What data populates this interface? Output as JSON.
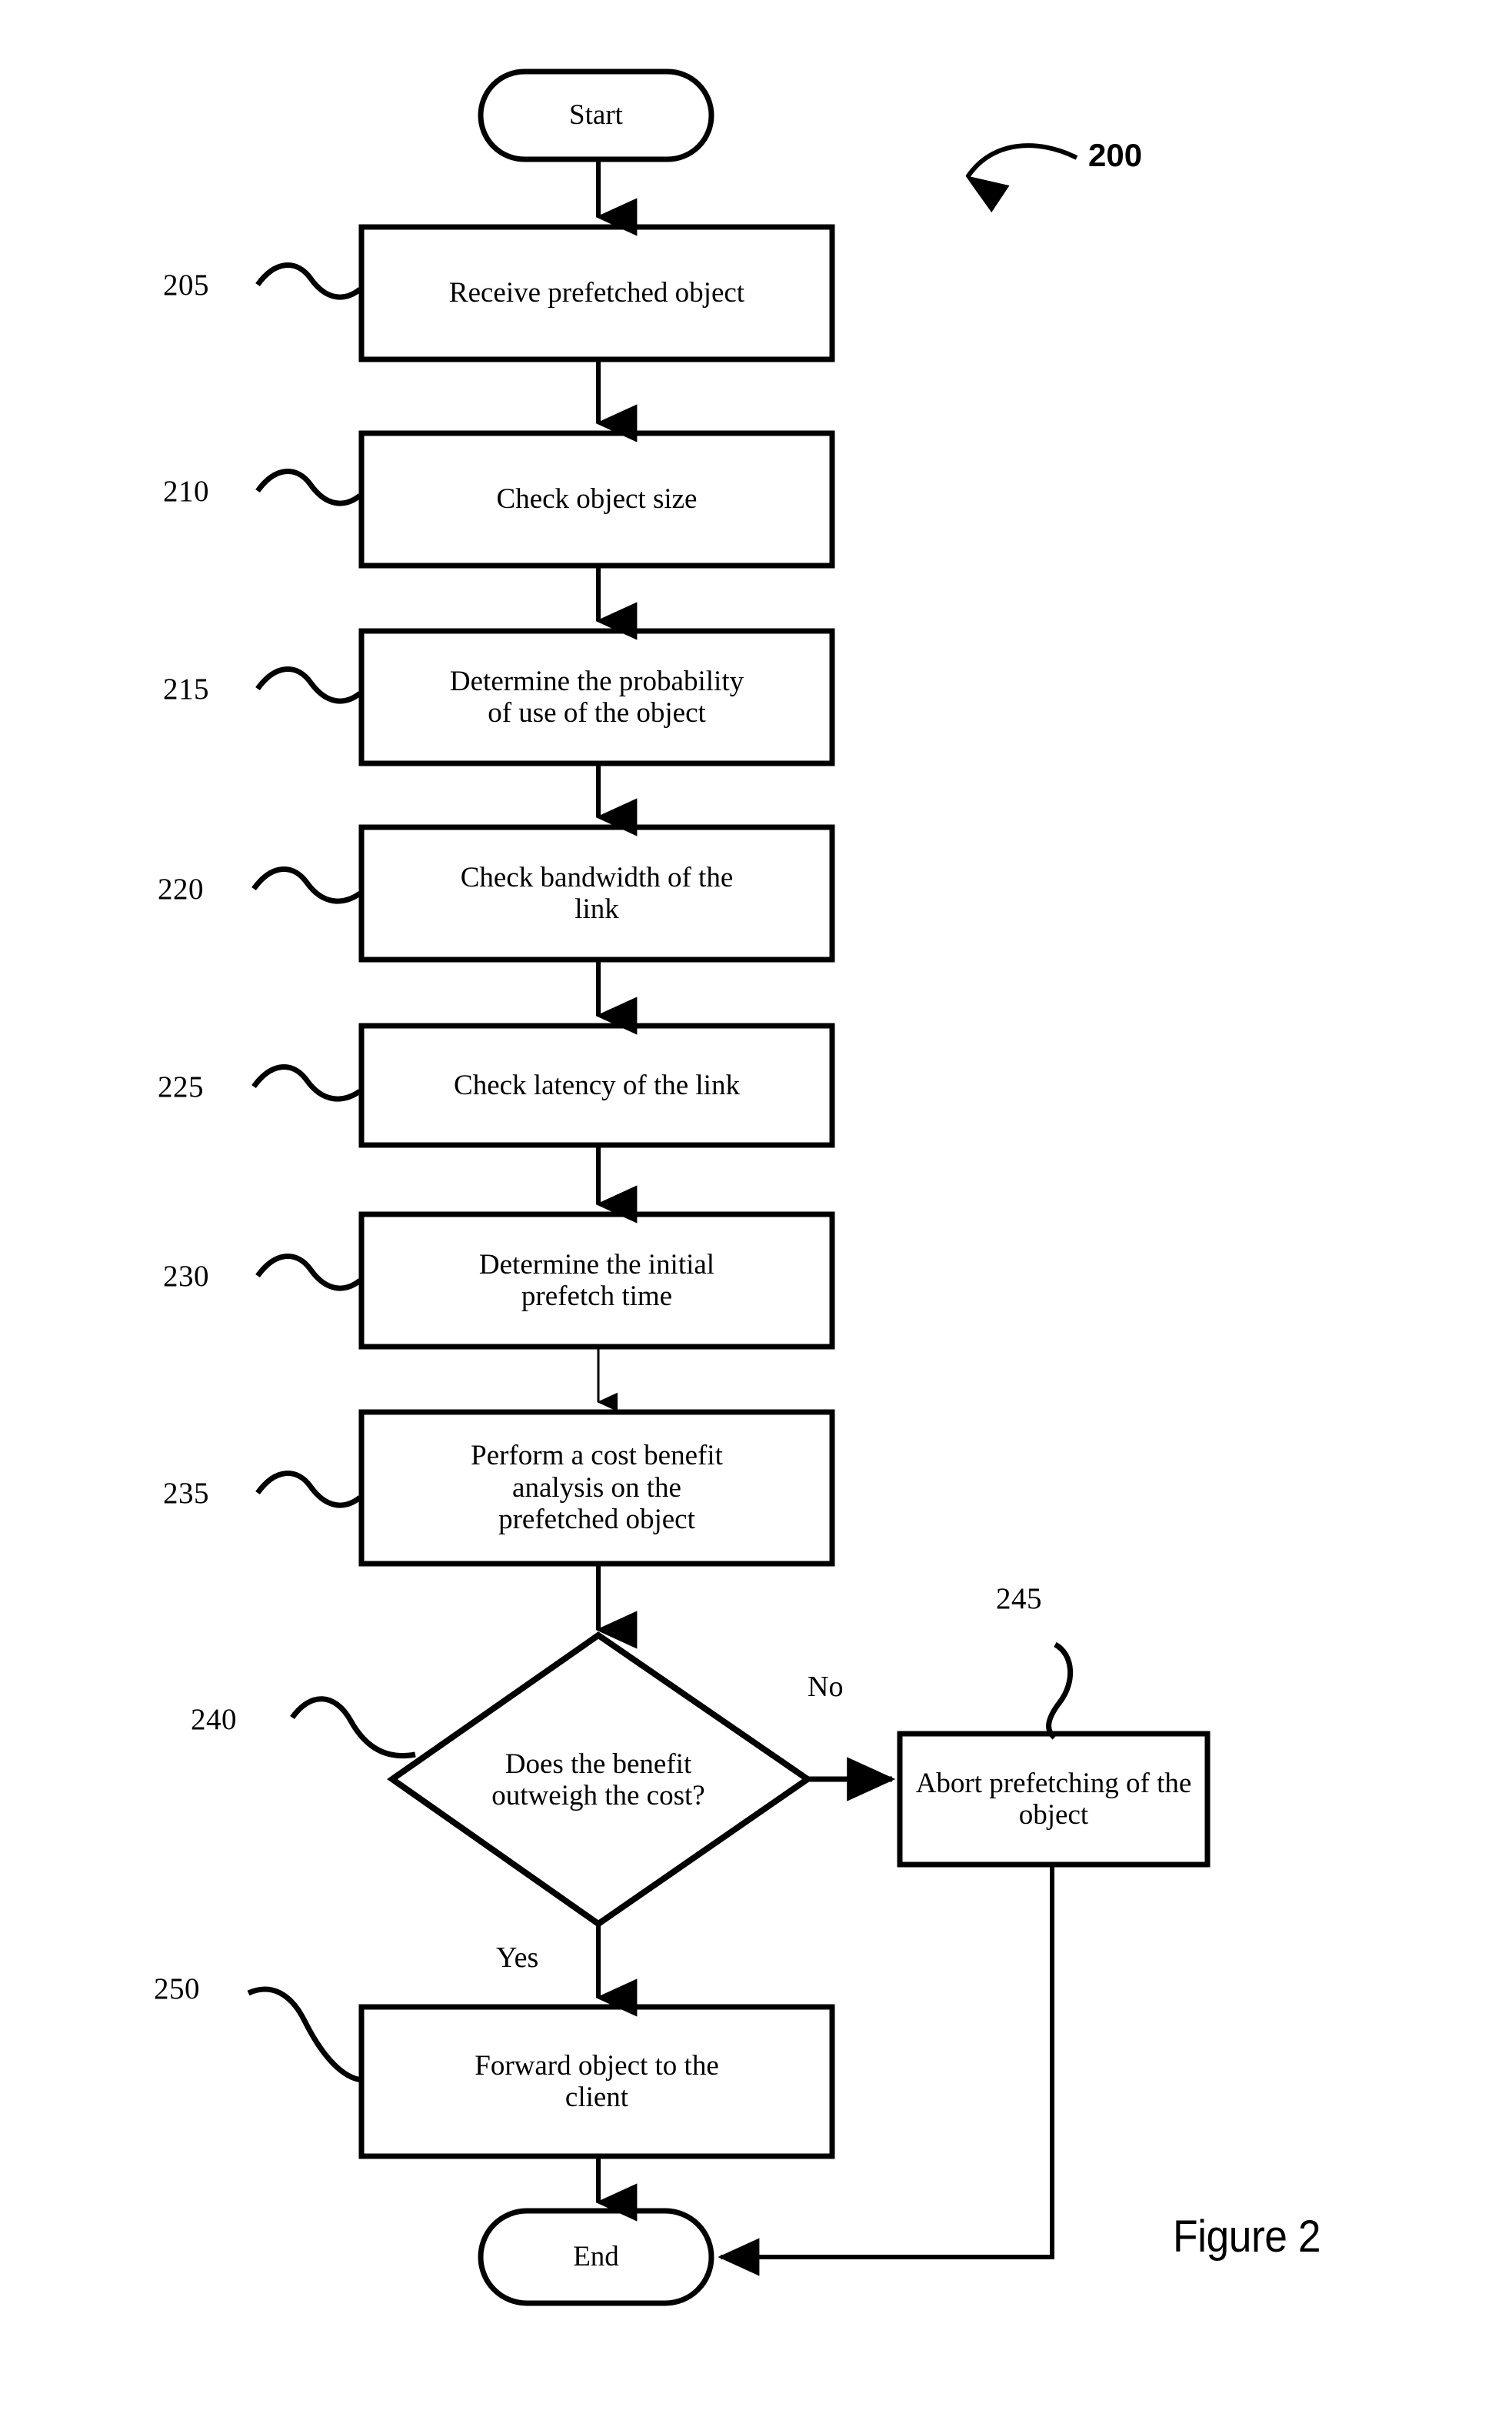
{
  "figure": {
    "caption": "Figure 2",
    "flow_number": "200"
  },
  "terminators": {
    "start": "Start",
    "end": "End"
  },
  "steps": [
    {
      "ref": "205",
      "label": "Receive prefetched object"
    },
    {
      "ref": "210",
      "label": "Check object size"
    },
    {
      "ref": "215",
      "label": "Determine the probability\nof use of the object"
    },
    {
      "ref": "220",
      "label": "Check bandwidth of the\nlink"
    },
    {
      "ref": "225",
      "label": "Check latency of the link"
    },
    {
      "ref": "230",
      "label": "Determine the initial\nprefetch time"
    },
    {
      "ref": "235",
      "label": "Perform a cost benefit\nanalysis on the\nprefetched object"
    }
  ],
  "decision": {
    "ref": "240",
    "label": "Does the benefit\noutweigh the cost?",
    "branch_no": "No",
    "branch_yes": "Yes"
  },
  "abort": {
    "ref": "245",
    "label": "Abort prefetching of the\nobject"
  },
  "forward": {
    "ref": "250",
    "label": "Forward object to the\nclient"
  },
  "colors": {
    "stroke": "#000000",
    "fill": "#ffffff",
    "text": "#000000"
  }
}
